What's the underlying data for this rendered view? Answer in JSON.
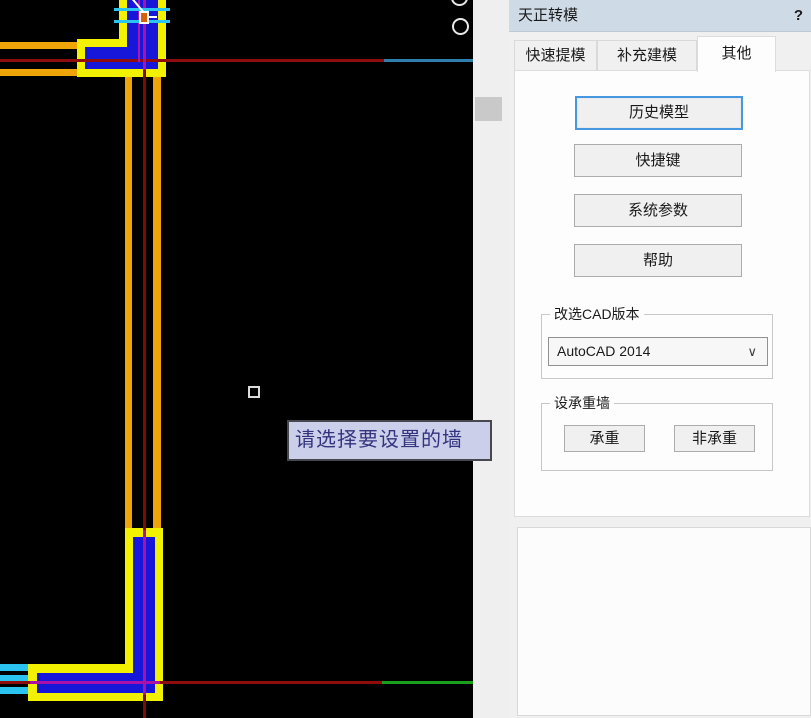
{
  "window": {
    "title": "天正转模",
    "help_glyph": "?"
  },
  "tabs": [
    {
      "label": "快速提模",
      "active": false
    },
    {
      "label": "补充建模",
      "active": false
    },
    {
      "label": "其他",
      "active": true
    }
  ],
  "actions": {
    "history_model": "历史模型",
    "hotkeys": "快捷键",
    "system_params": "系统参数",
    "help": "帮助"
  },
  "cad_version": {
    "group_label": "改选CAD版本",
    "selected": "AutoCAD 2014",
    "chevron": "∨"
  },
  "bearing_wall": {
    "group_label": "设承重墙",
    "bearing": "承重",
    "non_bearing": "非承重"
  },
  "canvas": {
    "tooltip": "请选择要设置的墙"
  },
  "colors": {
    "canvas_bg": "#000000",
    "wall_gold": "#efa40a",
    "selection_yellow": "#f2f200",
    "wall_fill_blue": "#1717da",
    "axis_red": "#8f0d0d",
    "axis_steel_blue": "#2e7fae",
    "axis_green": "#1ca01c",
    "axis_magenta": "#a911a9",
    "window_cyan": "#2bc4f0",
    "tooltip_bg": "#cbcfe9",
    "tooltip_text": "#33337e",
    "titlebar_bg": "#cedae6",
    "focus_border": "#4698e0"
  }
}
